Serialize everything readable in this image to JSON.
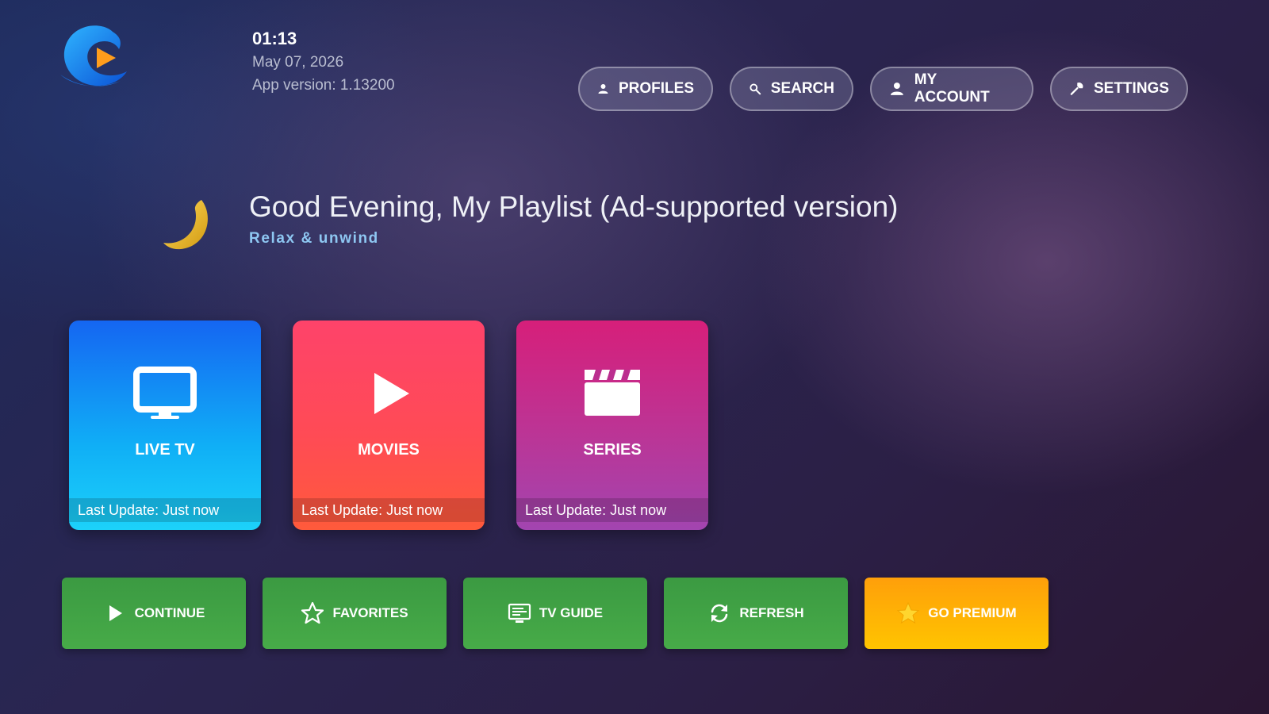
{
  "clock": {
    "time": "01:13",
    "date": "May 07, 2026",
    "version": "App version: 1.13200"
  },
  "nav": {
    "profiles": "PROFILES",
    "search": "SEARCH",
    "account": "MY ACCOUNT",
    "settings": "SETTINGS"
  },
  "greeting": {
    "title": "Good Evening, My Playlist (Ad-supported version)",
    "subtitle": "Relax & unwind"
  },
  "tiles": [
    {
      "label": "LIVE TV",
      "footer": "Last Update: Just now",
      "icon": "tv-icon"
    },
    {
      "label": "MOVIES",
      "footer": "Last Update: Just now",
      "icon": "play-icon"
    },
    {
      "label": "SERIES",
      "footer": "Last Update: Just now",
      "icon": "clapperboard-icon"
    }
  ],
  "actions": {
    "continue": "CONTINUE",
    "favorites": "FAVORITES",
    "tvguide": "TV GUIDE",
    "refresh": "REFRESH",
    "premium": "GO PREMIUM"
  },
  "colors": {
    "live_tv": "#10aff6",
    "movies": "#ff4b55",
    "series": "#bb3596",
    "action_green": "#47ab48",
    "premium": "#ffb000",
    "subtitle": "#8ec7f2"
  }
}
